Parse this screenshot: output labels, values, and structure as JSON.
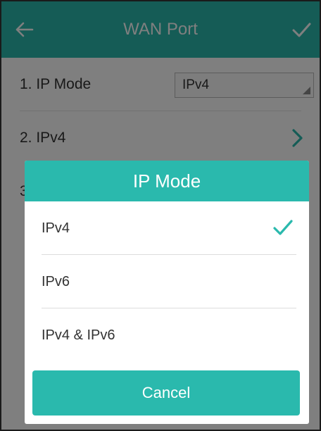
{
  "header": {
    "title": "WAN Port",
    "back_icon": "arrow-left-icon",
    "confirm_icon": "checkmark-icon"
  },
  "settings": [
    {
      "label": "1. IP Mode",
      "value": "IPv4"
    },
    {
      "label": "2. IPv4"
    },
    {
      "label": "3."
    }
  ],
  "dialog": {
    "title": "IP Mode",
    "options": [
      {
        "label": "IPv4",
        "selected": true
      },
      {
        "label": "IPv6",
        "selected": false
      },
      {
        "label": "IPv4 & IPv6",
        "selected": false
      }
    ],
    "cancel_label": "Cancel"
  },
  "colors": {
    "accent": "#2ab9ad",
    "overlay": "rgba(0,0,0,0.5)",
    "text": "#333333"
  }
}
